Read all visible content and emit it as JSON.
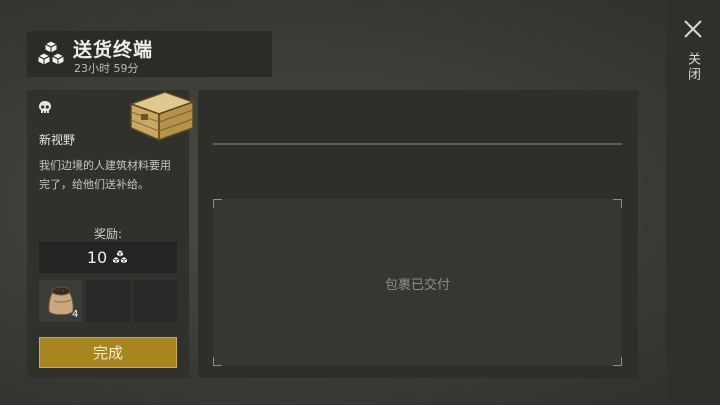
{
  "header": {
    "title": "送货终端",
    "timer": "23小时 59分"
  },
  "close": {
    "label": "关闭"
  },
  "quest": {
    "name": "新视野",
    "description": "我们边境的人建筑材料要用完了，给他们送补给。",
    "reward_label": "奖励:",
    "reward_amount": "10",
    "items": [
      {
        "icon": "seed-bag-icon",
        "count": "4"
      },
      {
        "icon": "",
        "count": ""
      },
      {
        "icon": "",
        "count": ""
      }
    ],
    "complete_button": "完成"
  },
  "delivery": {
    "status_text": "包裹已交付"
  },
  "colors": {
    "accent_button": "#a8861f",
    "panel": "#2f312d"
  }
}
